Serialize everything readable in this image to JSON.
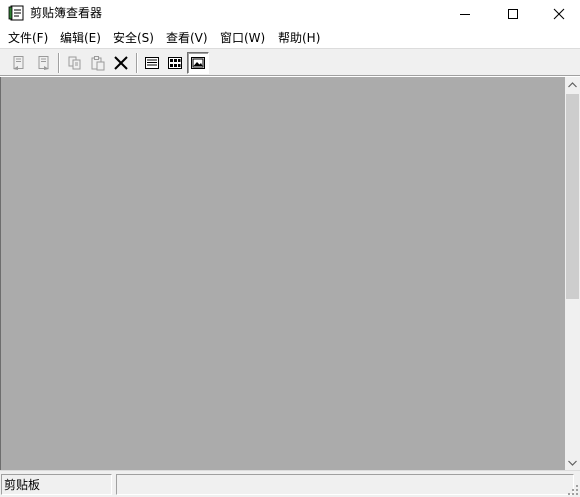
{
  "window": {
    "title": "剪贴簿查看器",
    "controls": {
      "minimize_icon": "minimize-icon",
      "maximize_icon": "maximize-icon",
      "close_icon": "close-icon"
    }
  },
  "menubar": {
    "items": [
      {
        "label": "文件(F)"
      },
      {
        "label": "编辑(E)"
      },
      {
        "label": "安全(S)"
      },
      {
        "label": "查看(V)"
      },
      {
        "label": "窗口(W)"
      },
      {
        "label": "帮助(H)"
      }
    ]
  },
  "toolbar": {
    "buttons": [
      {
        "icon": "connect-icon",
        "enabled": false
      },
      {
        "icon": "disconnect-icon",
        "enabled": false
      },
      {
        "icon": "copy-icon",
        "enabled": false
      },
      {
        "icon": "paste-icon",
        "enabled": false
      },
      {
        "icon": "delete-icon",
        "enabled": true
      },
      {
        "icon": "table-of-contents-icon",
        "enabled": true
      },
      {
        "icon": "thumbnails-icon",
        "enabled": true
      },
      {
        "icon": "full-page-icon",
        "enabled": true,
        "pressed": true
      }
    ]
  },
  "statusbar": {
    "pane1": "剪贴板",
    "pane2": ""
  },
  "colors": {
    "client_background": "#ababab",
    "chrome": "#f0f0f0",
    "disabled_icon": "#9a9a9a"
  }
}
